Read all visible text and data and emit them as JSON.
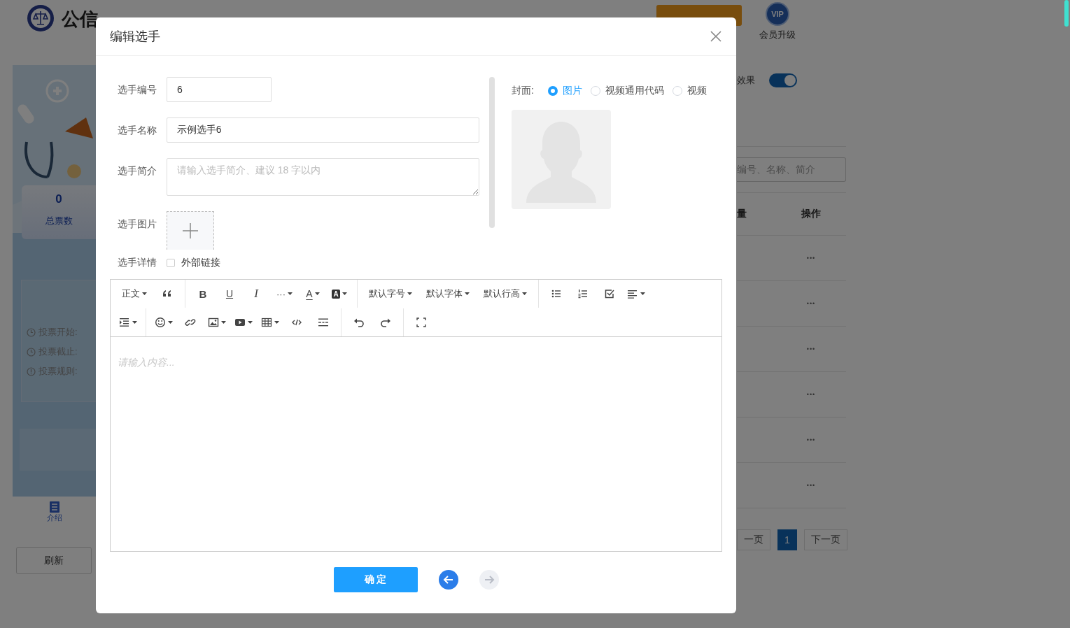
{
  "background": {
    "logo": "公信",
    "vip_badge": "VIP",
    "vip_label": "会员升级",
    "left_panel": {
      "total_votes": "0",
      "total_votes_label": "总票数",
      "info": [
        {
          "kind": "time",
          "label": "投票开始:"
        },
        {
          "kind": "time",
          "label": "投票截止:"
        },
        {
          "kind": "rule",
          "label": "投票规则:"
        }
      ],
      "tab": "介绍",
      "refresh_button": "刷新"
    },
    "right_panel": {
      "toggle_label": "效果",
      "toggle_on": true,
      "search_placeholder": "编号、名称、简介",
      "columns": [
        "量",
        "操作"
      ],
      "rows": [
        {
          "action": "•••"
        },
        {
          "action": "•••"
        },
        {
          "action": "•••"
        },
        {
          "action": "•••"
        },
        {
          "action": "•••"
        },
        {
          "action": "•••"
        }
      ],
      "pagination": [
        {
          "label": "一页",
          "selected": false
        },
        {
          "label": "1",
          "selected": true
        },
        {
          "label": "下一页",
          "selected": false
        }
      ]
    }
  },
  "dialog": {
    "title": "编辑选手",
    "fields": [
      {
        "kind": "input",
        "label": "选手编号",
        "value": "6"
      },
      {
        "kind": "input",
        "label": "选手名称",
        "value": "示例选手6"
      },
      {
        "kind": "textarea",
        "label": "选手简介",
        "placeholder": "请输入选手简介、建议 18 字以内"
      },
      {
        "kind": "upload",
        "label": "选手图片"
      },
      {
        "kind": "checkbox",
        "label": "选手详情",
        "option": "外部链接",
        "checked": false
      }
    ],
    "cover": {
      "label": "封面:",
      "options": [
        {
          "label": "图片",
          "selected": true
        },
        {
          "label": "视频通用代码",
          "selected": false
        },
        {
          "label": "视频",
          "selected": false
        }
      ]
    },
    "toolbar": [
      [
        [
          {
            "kind": "text",
            "label": "正文",
            "dropdown": true
          },
          {
            "kind": "icon",
            "dropdown": false
          }
        ],
        [
          {
            "kind": "bold",
            "label": "B",
            "dropdown": false
          },
          {
            "kind": "underline",
            "label": "U",
            "dropdown": false
          },
          {
            "kind": "italic",
            "label": "I",
            "dropdown": false
          },
          {
            "kind": "text",
            "label": "···",
            "dropdown": true
          },
          {
            "kind": "color",
            "label": "A",
            "dropdown": true
          },
          {
            "kind": "boxed",
            "label": "A",
            "dropdown": true
          }
        ],
        [
          {
            "kind": "text",
            "label": "默认字号",
            "dropdown": true
          },
          {
            "kind": "text",
            "label": "默认字体",
            "dropdown": true
          },
          {
            "kind": "text",
            "label": "默认行高",
            "dropdown": true
          }
        ],
        [
          {
            "kind": "icon",
            "dropdown": false
          },
          {
            "kind": "icon",
            "dropdown": false
          },
          {
            "kind": "icon",
            "dropdown": false
          },
          {
            "kind": "icon",
            "dropdown": true
          }
        ]
      ],
      [
        [
          {
            "kind": "icon",
            "dropdown": true
          }
        ],
        [
          {
            "kind": "icon",
            "dropdown": true
          },
          {
            "kind": "icon",
            "dropdown": false
          },
          {
            "kind": "icon",
            "dropdown": true
          },
          {
            "kind": "icon",
            "dropdown": true
          },
          {
            "kind": "icon",
            "dropdown": true
          },
          {
            "kind": "icon",
            "dropdown": false
          },
          {
            "kind": "icon",
            "dropdown": false
          }
        ],
        [
          {
            "kind": "icon",
            "dropdown": false
          },
          {
            "kind": "icon",
            "dropdown": false
          }
        ],
        [
          {
            "kind": "icon",
            "dropdown": false
          }
        ]
      ]
    ],
    "editor_placeholder": "请输入内容...",
    "confirm_button": "确 定",
    "back_enabled": true,
    "forward_enabled": false
  }
}
